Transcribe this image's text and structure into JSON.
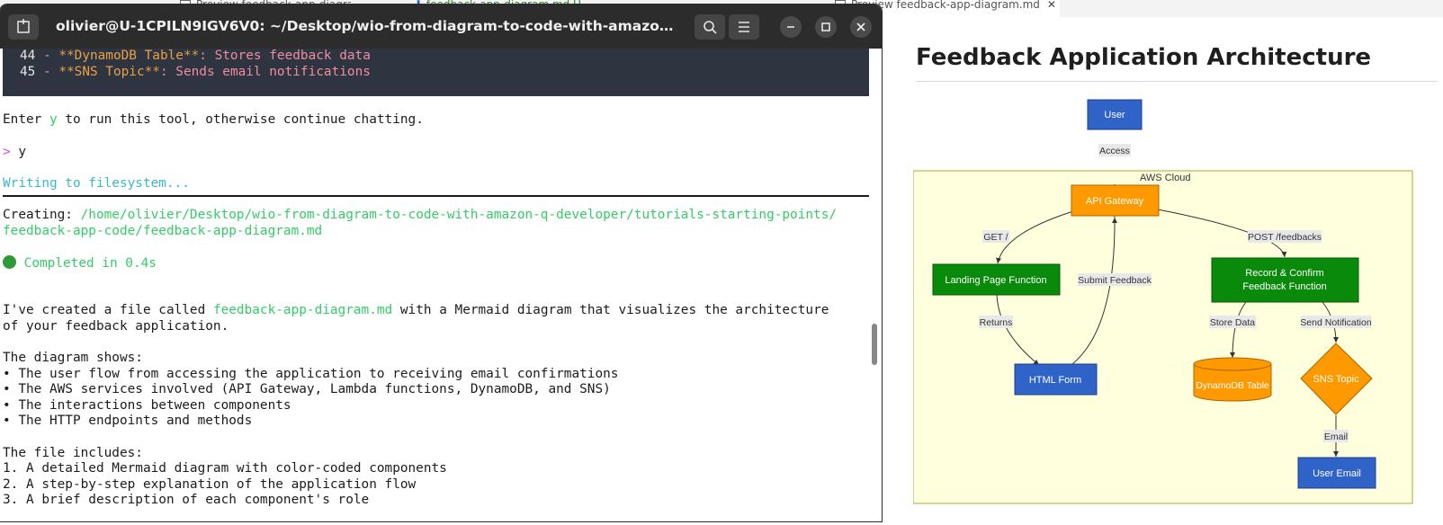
{
  "editor_tabs": [
    {
      "label": "Preview feedback-app-diagram.md"
    },
    {
      "label": "feedback-app-diagram.md U"
    },
    {
      "label": "Preview feedback-app-diagram.md"
    }
  ],
  "terminal": {
    "title": "olivier@U-1CPILN9IGV6V0: ~/Desktop/wio-from-diagram-to-code-with-amazon-q-developer/tutorials-starting-points/feedback-app-code",
    "code_lines": [
      {
        "num": "44",
        "dash": " - ",
        "bold": "**DynamoDB Table**",
        "rest": ": Stores feedback data"
      },
      {
        "num": "45",
        "dash": " - ",
        "bold": "**SNS Topic**",
        "rest": ": Sends email notifications"
      }
    ],
    "prompt_pre": "Enter ",
    "prompt_y": "y",
    "prompt_post": " to run this tool, otherwise continue chatting.",
    "input_marker": ">",
    "input_value": "y",
    "writing": "Writing to filesystem...",
    "creating_label": "Creating: ",
    "creating_path_1": "/home/olivier/Desktop/wio-from-diagram-to-code-with-amazon-q-developer/tutorials-starting-points/",
    "creating_path_2": "feedback-app-code/feedback-app-diagram.md",
    "completed": "Completed in 0.4s",
    "para1_pre": "I've created a file called ",
    "para1_file": "feedback-app-diagram.md",
    "para1_post": " with a Mermaid diagram that visualizes the architecture",
    "para1_line2": "of your feedback application.",
    "shows_heading": "The diagram shows:",
    "shows_items": [
      "• The user flow from accessing the application to receiving email confirmations",
      "• The AWS services involved (API Gateway, Lambda functions, DynamoDB, and SNS)",
      "• The interactions between components",
      "• The HTTP endpoints and methods"
    ],
    "includes_heading": "The file includes:",
    "includes_items": [
      "1. A detailed Mermaid diagram with color-coded components",
      "2. A step-by-step explanation of the application flow",
      "3. A brief description of each component's role"
    ]
  },
  "preview": {
    "title": "Feedback Application Architecture"
  },
  "diagram": {
    "nodes": {
      "user": "User",
      "cloud": "AWS Cloud",
      "api_gateway": "API Gateway",
      "landing": "Landing Page Function",
      "html_form": "HTML Form",
      "record_1": "Record & Confirm",
      "record_2": "Feedback Function",
      "dynamodb": "DynamoDB Table",
      "sns": "SNS Topic",
      "user_email": "User Email"
    },
    "edges": {
      "access": "Access",
      "get": "GET /",
      "post": "POST /feedbacks",
      "returns": "Returns",
      "submit": "Submit Feedback",
      "store": "Store Data",
      "notify": "Send Notification",
      "email": "Email"
    },
    "colors": {
      "blue": "#2f63c8",
      "orange": "#ff9900",
      "green": "#0a8a0a",
      "cloud_fill": "#ffffde",
      "cloud_border": "#aaaa33"
    }
  }
}
